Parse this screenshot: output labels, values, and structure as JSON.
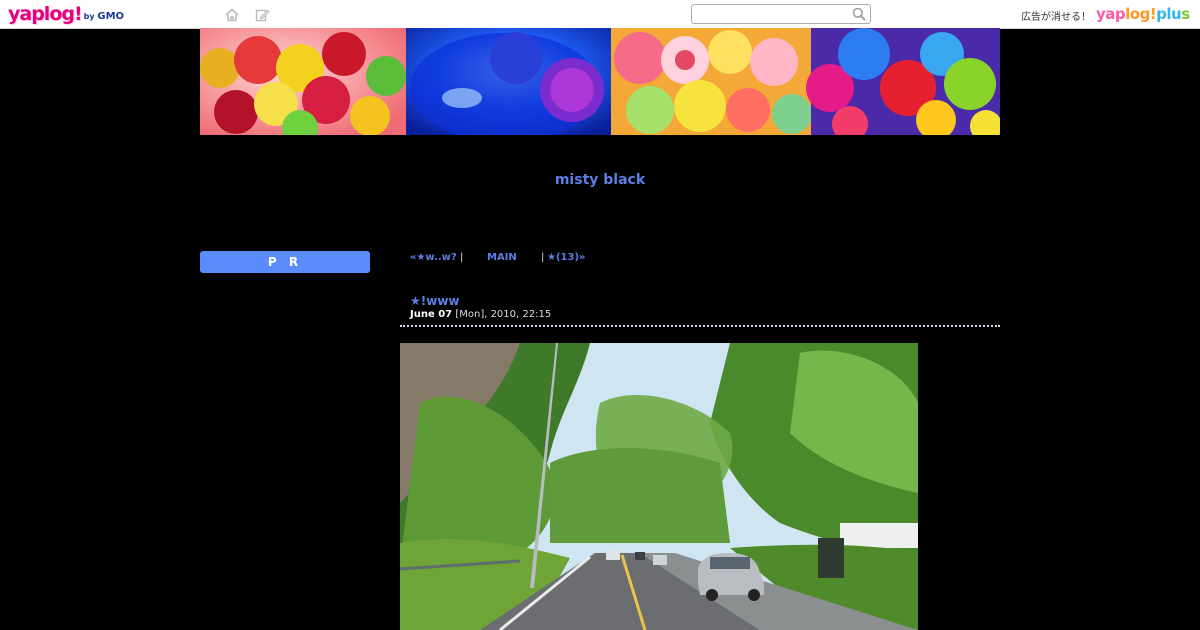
{
  "topbar": {
    "logo_main": "yaplog!",
    "logo_by": "by",
    "logo_gmo": "GMO",
    "icons": [
      "home-icon",
      "edit-icon",
      "search-icon"
    ],
    "search_placeholder": "",
    "ad_text": "広告が消せる！",
    "plus_logo": [
      "yap",
      "log!",
      "plu",
      "s"
    ]
  },
  "colors": {
    "background": "#000000",
    "accent": "#5c7fe6",
    "pr_box": "#5a8dfb"
  },
  "blog": {
    "title": "misty black"
  },
  "sidebar": {
    "pr_label": "P R"
  },
  "nav": {
    "prev": "«★w..w?",
    "sep": "|",
    "main": "MAIN",
    "next": "★(13)»"
  },
  "entry": {
    "title": "★!www",
    "date_bold": "June 07",
    "date_rest": "[Mon], 2010, 22:15"
  }
}
